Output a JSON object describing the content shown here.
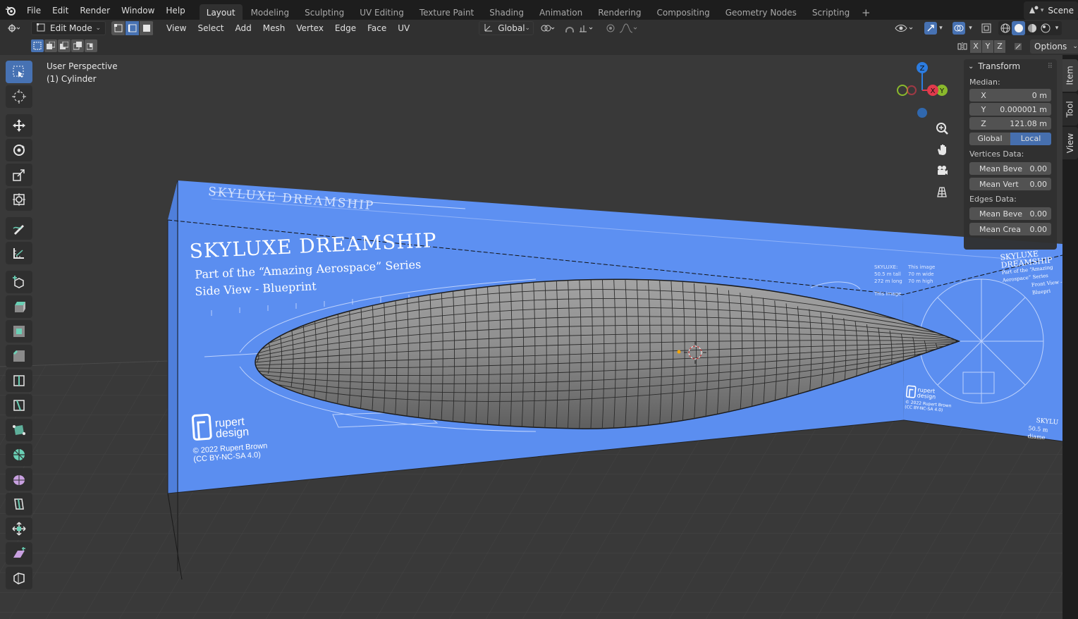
{
  "menubar": {
    "items": [
      "File",
      "Edit",
      "Render",
      "Window",
      "Help"
    ],
    "workspaces": [
      "Layout",
      "Modeling",
      "Sculpting",
      "UV Editing",
      "Texture Paint",
      "Shading",
      "Animation",
      "Rendering",
      "Compositing",
      "Geometry Nodes",
      "Scripting"
    ],
    "active_workspace": "Layout",
    "add_tab": "+",
    "scene": "Scene"
  },
  "header": {
    "mode": "Edit Mode",
    "menus": [
      "View",
      "Select",
      "Add",
      "Mesh",
      "Vertex",
      "Edge",
      "Face",
      "UV"
    ],
    "transform_orientation": "Global",
    "axis_buttons": [
      "X",
      "Y",
      "Z"
    ],
    "options_label": "Options"
  },
  "viewport": {
    "perspective": "User Perspective",
    "object": "(1) Cylinder",
    "gizmo_axes": {
      "x": "X",
      "y": "Y",
      "z": "Z"
    },
    "colors": {
      "x": "#e23a4c",
      "y": "#8ab92c",
      "z": "#2c7ce0",
      "blueprint": "#5b8ef0"
    }
  },
  "blueprint": {
    "title": "SKYLUXE DREAMSHIP",
    "series": "Part of the “Amazing Aerospace” Series",
    "view": "Side View - Blueprint",
    "brand_1": "rupert",
    "brand_2": "design",
    "copyright": "© 2022 Rupert Brown",
    "license": "(CC BY-NC-SA 4.0)",
    "side_title": "SKYLUXE DREAMSHIP",
    "side_series": "Part of the “Amazing Aerospace” Series",
    "side_view": "Front View - Bluepri",
    "specs": [
      "SKYLUXE:",
      "50.5 m tall",
      "272 m long"
    ],
    "note1": "This image",
    "note2": "70 m wide",
    "note3": "70 m high",
    "note4": "This image",
    "side_brand_1": "rupert",
    "side_brand_2": "design",
    "side_copyright": "© 2022 Rupert Brown",
    "side_license": "(CC BY-NC-SA 4.0)",
    "side_footer_1": "SKYLU",
    "side_footer_2": "50.5 m diame"
  },
  "npanel": {
    "section": "Transform",
    "median_label": "Median:",
    "fields": [
      {
        "axis": "X",
        "value": "0 m"
      },
      {
        "axis": "Y",
        "value": "0.000001 m"
      },
      {
        "axis": "Z",
        "value": "121.08 m"
      }
    ],
    "toggle": {
      "left": "Global",
      "right": "Local",
      "active": "Local"
    },
    "vertices_label": "Vertices Data:",
    "vertices": [
      {
        "label": "Mean Beve",
        "value": "0.00"
      },
      {
        "label": "Mean Vert",
        "value": "0.00"
      }
    ],
    "edges_label": "Edges Data:",
    "edges": [
      {
        "label": "Mean Beve",
        "value": "0.00"
      },
      {
        "label": "Mean Crea",
        "value": "0.00"
      }
    ],
    "tabs": [
      "Item",
      "Tool",
      "View"
    ]
  }
}
